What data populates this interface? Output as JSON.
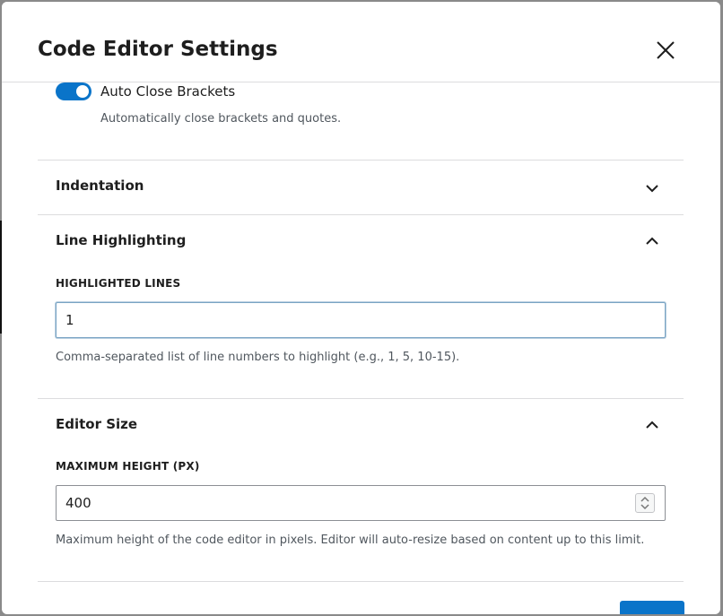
{
  "dialog": {
    "title": "Code Editor Settings",
    "close_icon": "close-icon"
  },
  "auto_close_brackets": {
    "label": "Auto Close Brackets",
    "help": "Automatically close brackets and quotes.",
    "enabled": true
  },
  "panels": {
    "indentation": {
      "title": "Indentation",
      "expanded": false,
      "icon": "chevron-down-icon"
    },
    "line_highlighting": {
      "title": "Line Highlighting",
      "expanded": true,
      "icon": "chevron-up-icon",
      "field_label": "HIGHLIGHTED LINES",
      "value": "1",
      "help": "Comma-separated list of line numbers to highlight (e.g., 1, 5, 10-15)."
    },
    "editor_size": {
      "title": "Editor Size",
      "expanded": true,
      "icon": "chevron-up-icon",
      "field_label": "MAXIMUM HEIGHT (PX)",
      "value": "400",
      "help": "Maximum height of the code editor in pixels. Editor will auto-resize based on content up to this limit."
    }
  },
  "colors": {
    "accent": "#0a74c9",
    "text": "#1e1e1e",
    "muted": "#50575e",
    "divider": "#dcdcde"
  }
}
